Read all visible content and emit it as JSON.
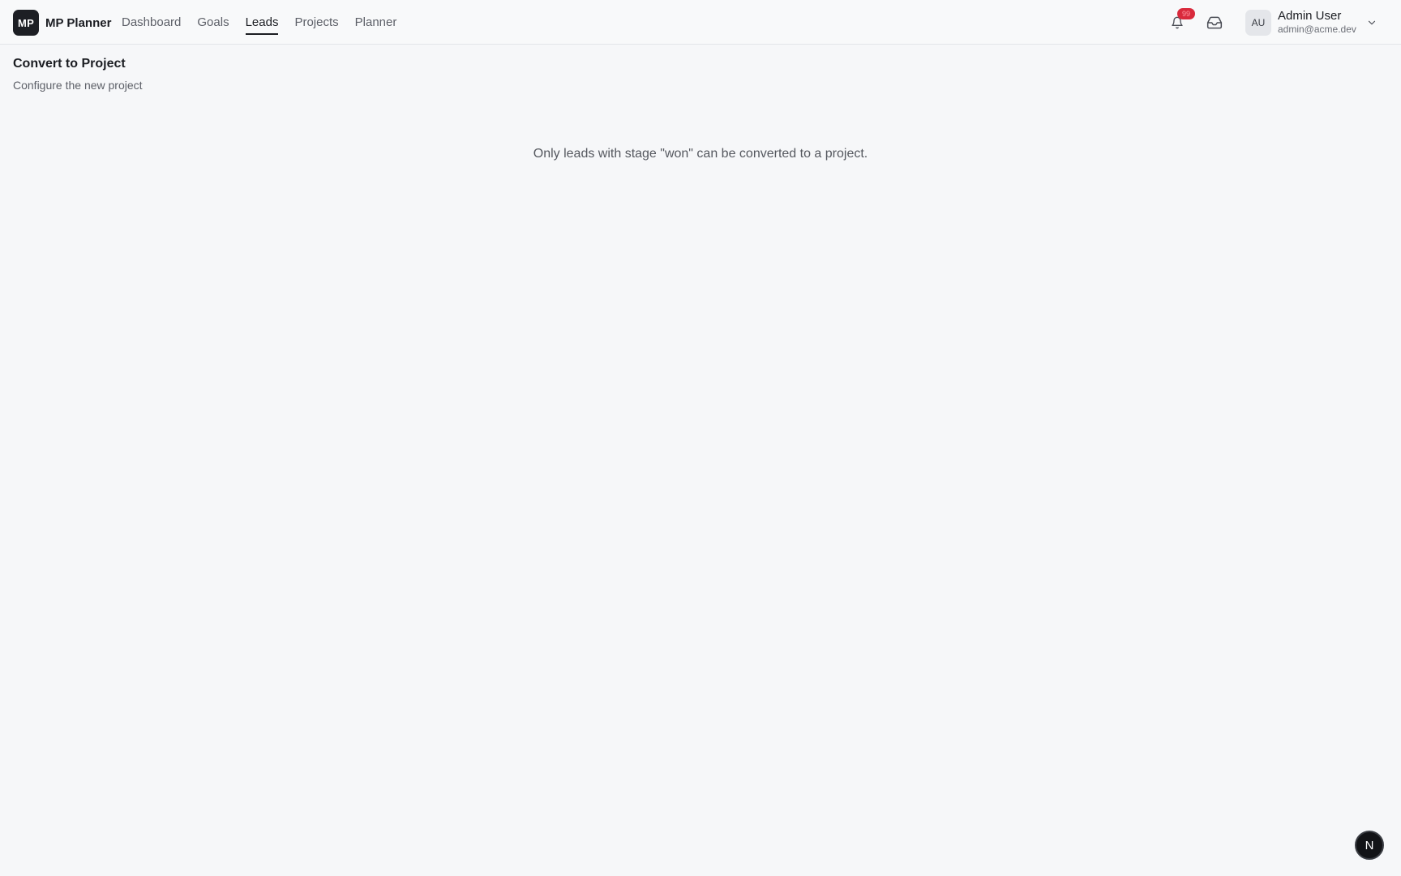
{
  "brand": {
    "badge": "MP",
    "name": "MP Planner"
  },
  "nav": {
    "items": [
      {
        "label": "Dashboard"
      },
      {
        "label": "Goals"
      },
      {
        "label": "Leads",
        "active": true
      },
      {
        "label": "Projects"
      },
      {
        "label": "Planner"
      }
    ]
  },
  "header": {
    "notification_count": "99",
    "user": {
      "initials": "AU",
      "name": "Admin User",
      "email": "admin@acme.dev"
    }
  },
  "page": {
    "title": "Convert to Project",
    "subtitle": "Configure the new project",
    "notice": "Only leads with stage \"won\" can be converted to a project."
  },
  "fab": {
    "label": "N"
  },
  "colors": {
    "background": "#f6f7f9",
    "brand_badge": "#1d1f24",
    "notification_badge": "#d92a3c"
  },
  "icons": {
    "notifications": "bell-icon",
    "inbox": "inbox-icon",
    "user_menu": "chevron-down-icon"
  }
}
